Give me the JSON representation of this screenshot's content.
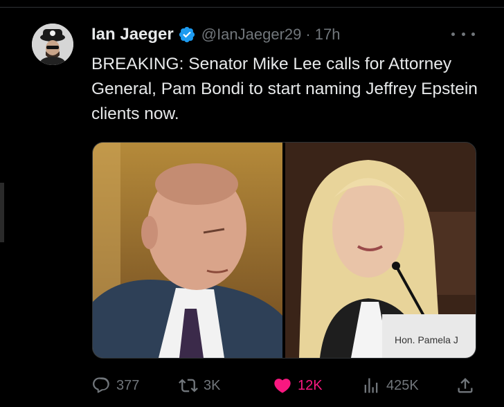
{
  "tweet": {
    "author": {
      "display_name": "Ian Jaeger",
      "handle": "@IanJaeger29",
      "verified": true
    },
    "separator": "·",
    "time": "17h",
    "text": "BREAKING: Senator Mike Lee calls for Attorney General, Pam Bondi to start naming Jeffrey Epstein clients now.",
    "media": {
      "images": [
        {
          "alt": "Mike Lee"
        },
        {
          "alt": "Pam Bondi",
          "nameplate": "Hon. Pamela J"
        }
      ]
    },
    "actions": {
      "replies": "377",
      "reposts": "3K",
      "likes": "12K",
      "views": "425K",
      "liked": true
    }
  },
  "colors": {
    "background": "#000000",
    "text": "#e7e9ea",
    "muted": "#71767b",
    "verified": "#1d9bf0",
    "like": "#f91880"
  },
  "icons": [
    "verified-badge-icon",
    "more-icon",
    "reply-icon",
    "repost-icon",
    "heart-icon",
    "views-icon",
    "share-icon"
  ]
}
